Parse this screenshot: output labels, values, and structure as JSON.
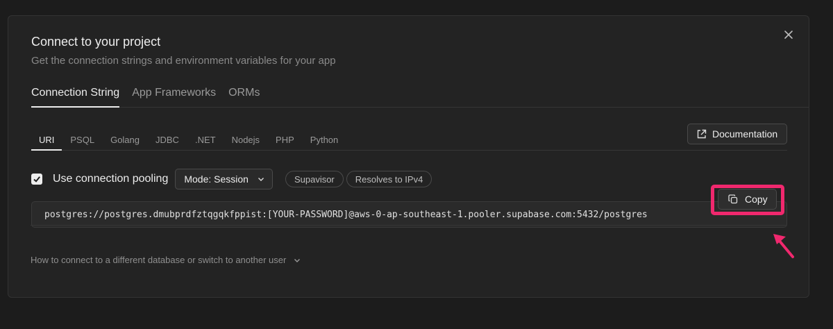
{
  "modal": {
    "title": "Connect to your project",
    "subtitle": "Get the connection strings and environment variables for your app"
  },
  "main_tabs": [
    {
      "label": "Connection String",
      "active": true
    },
    {
      "label": "App Frameworks",
      "active": false
    },
    {
      "label": "ORMs",
      "active": false
    }
  ],
  "sub_tabs": [
    {
      "label": "URI",
      "active": true
    },
    {
      "label": "PSQL",
      "active": false
    },
    {
      "label": "Golang",
      "active": false
    },
    {
      "label": "JDBC",
      "active": false
    },
    {
      "label": ".NET",
      "active": false
    },
    {
      "label": "Nodejs",
      "active": false
    },
    {
      "label": "PHP",
      "active": false
    },
    {
      "label": "Python",
      "active": false
    }
  ],
  "documentation_label": "Documentation",
  "pooling": {
    "checked": true,
    "label": "Use connection pooling",
    "mode": "Mode: Session",
    "badges": [
      "Supavisor",
      "Resolves to IPv4"
    ]
  },
  "connection_string": "postgres://postgres.dmubprdfztqgqkfppist:[YOUR-PASSWORD]@aws-0-ap-southeast-1.pooler.supabase.com:5432/postgres",
  "copy_label": "Copy",
  "howto_label": "How to connect to a different database or switch to another user",
  "colors": {
    "background": "#1c1c1c",
    "modal": "#232323",
    "highlight": "#f0286e"
  },
  "icons": [
    "close-icon",
    "external-link-icon",
    "check-icon",
    "chevron-down-icon",
    "copy-icon",
    "annotation-arrow"
  ]
}
